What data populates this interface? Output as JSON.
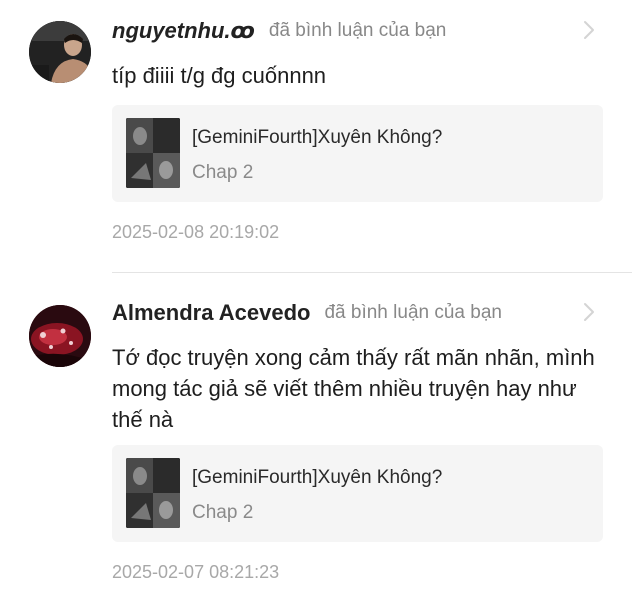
{
  "notifications": [
    {
      "username": "nguyetnhu.ꝏ",
      "action": "đã bình luận của bạn",
      "comment": "típ điiii t/g đg cuốnnnn",
      "story": {
        "title": "[GeminiFourth]Xuyên Không?",
        "chapter": "Chap 2"
      },
      "timestamp": "2025-02-08 20:19:02",
      "avatar_icon": "person-photo",
      "accent": "#2a2a2a"
    },
    {
      "username": "Almendra Acevedo",
      "action": "đã bình luận của bạn",
      "comment": "Tớ đọc truyện xong cảm thấy rất mãn nhãn, mình mong tác giả sẽ viết thêm nhiều truyện hay như thế nà",
      "story": {
        "title": "[GeminiFourth]Xuyên Không?",
        "chapter": "Chap 2"
      },
      "timestamp": "2025-02-07 08:21:23",
      "avatar_icon": "red-abstract-photo",
      "accent": "#8a1422"
    }
  ]
}
